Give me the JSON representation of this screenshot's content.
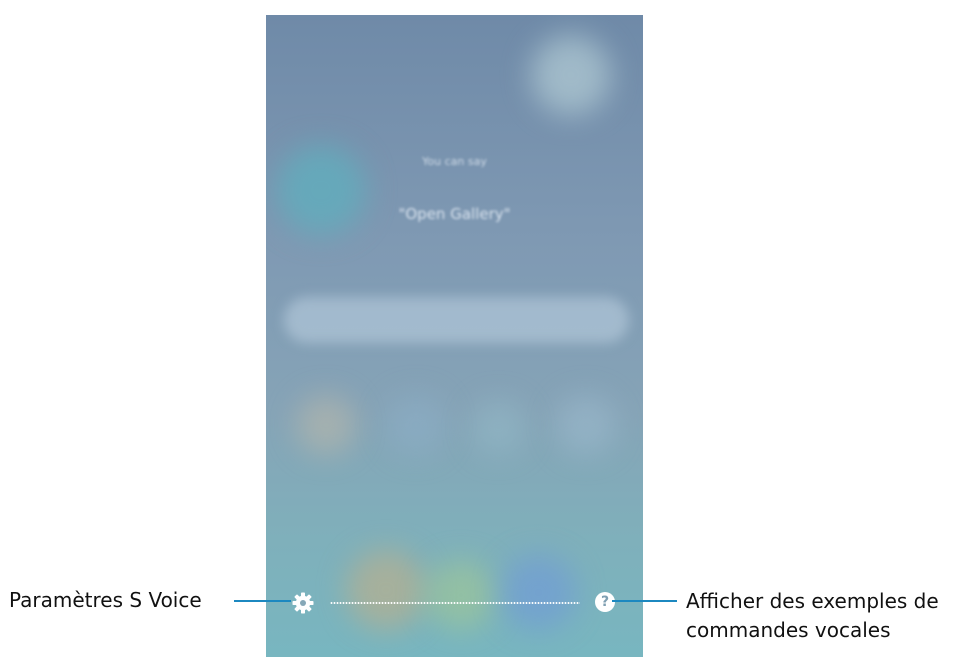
{
  "screen": {
    "hint_caption": "You can say",
    "hint_example": "\"Open Gallery\""
  },
  "bottom_bar": {
    "settings_icon": "gear-icon",
    "help_icon": "question-circle-icon",
    "help_glyph": "?"
  },
  "callouts": {
    "settings_label": "Paramètres S Voice",
    "help_label_line1": "Afficher des exemples de",
    "help_label_line2": "commandes vocales"
  },
  "colors": {
    "leader_line": "#1c88c0",
    "icon_fill": "#ffffff"
  }
}
